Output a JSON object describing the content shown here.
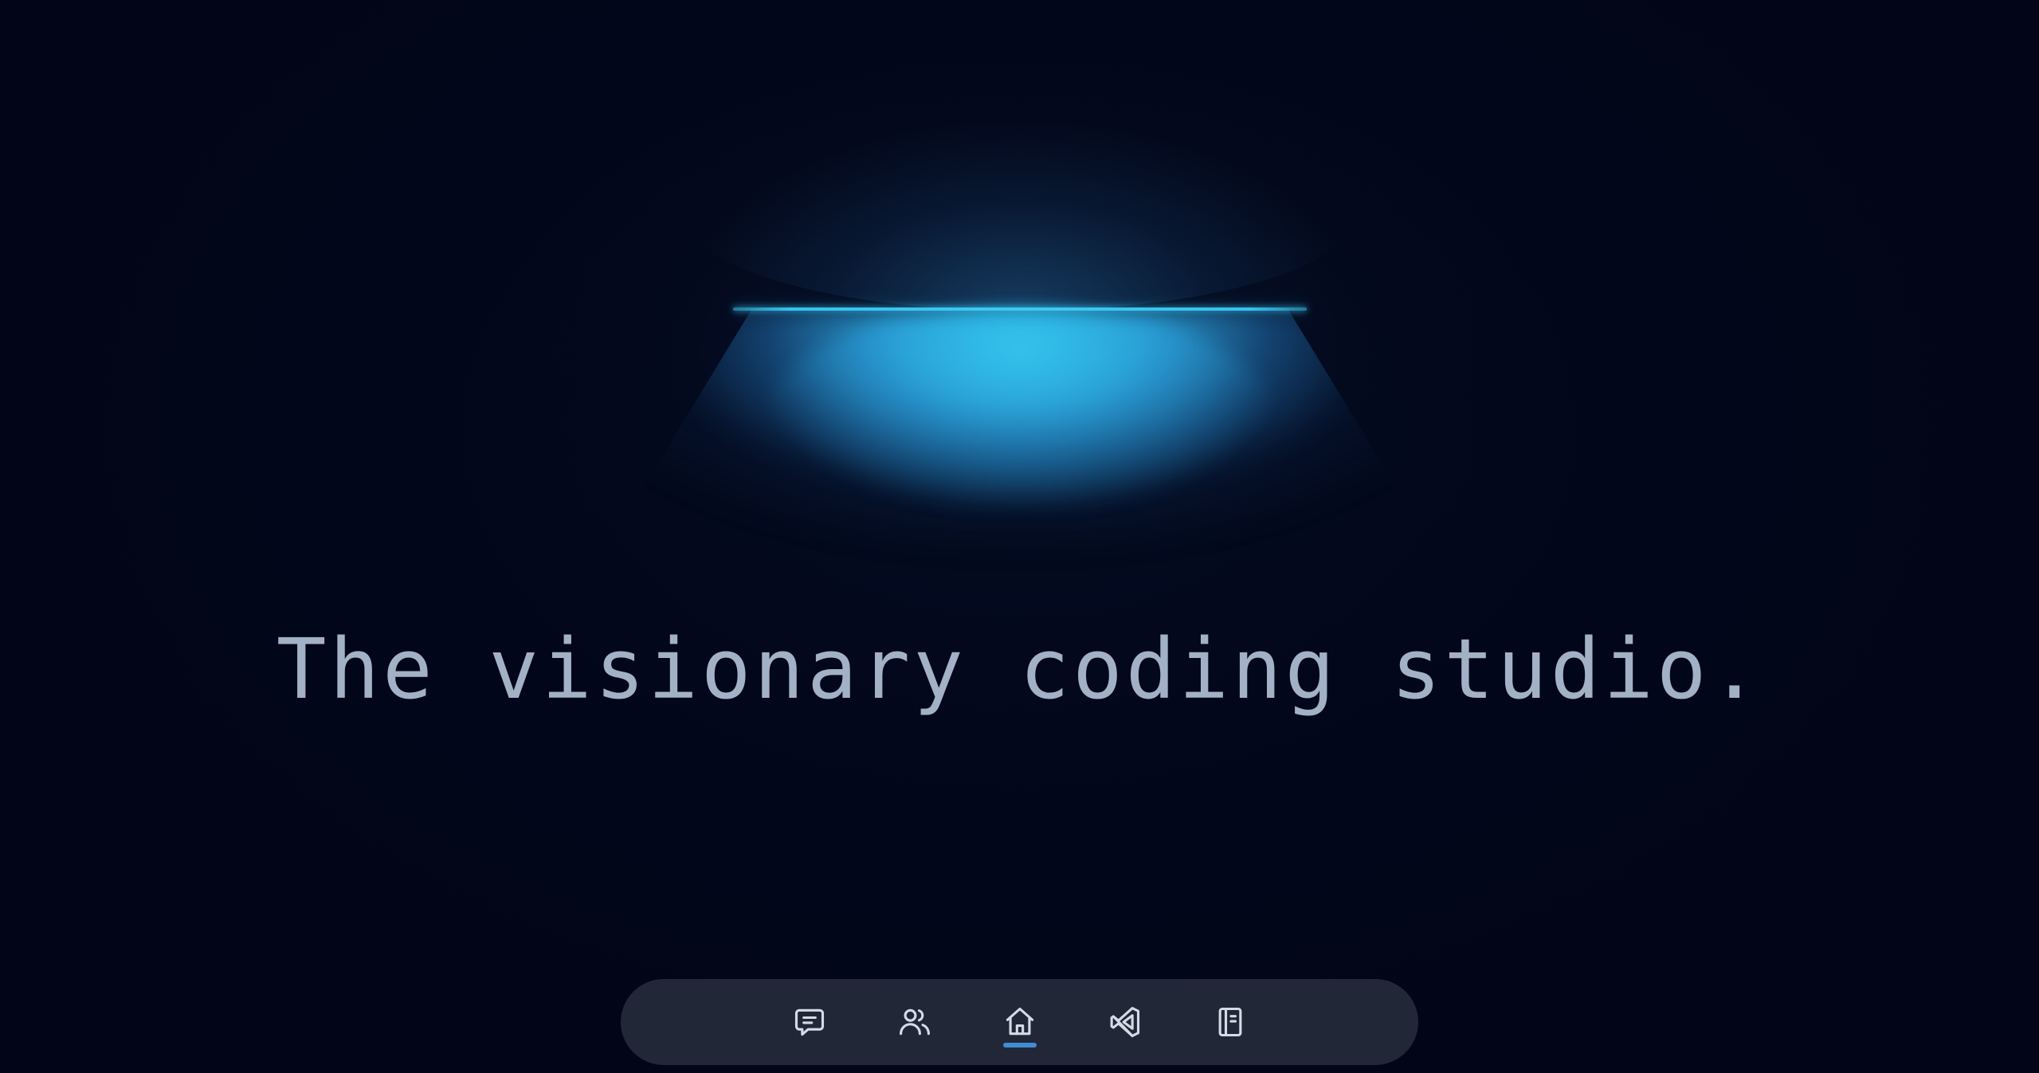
{
  "hero": {
    "headline": "The visionary coding studio."
  },
  "colors": {
    "background": "#02061a",
    "lamp_glow": "#36c2ee",
    "headline_text": "#a3b1c6",
    "dock_background": "#212736",
    "active_indicator": "#3e8ed6"
  },
  "dock": {
    "active_index": 2,
    "items": [
      {
        "icon": "chat-icon",
        "active": false
      },
      {
        "icon": "users-icon",
        "active": false
      },
      {
        "icon": "home-icon",
        "active": true
      },
      {
        "icon": "vscode-icon",
        "active": false
      },
      {
        "icon": "notebook-icon",
        "active": false
      }
    ]
  }
}
